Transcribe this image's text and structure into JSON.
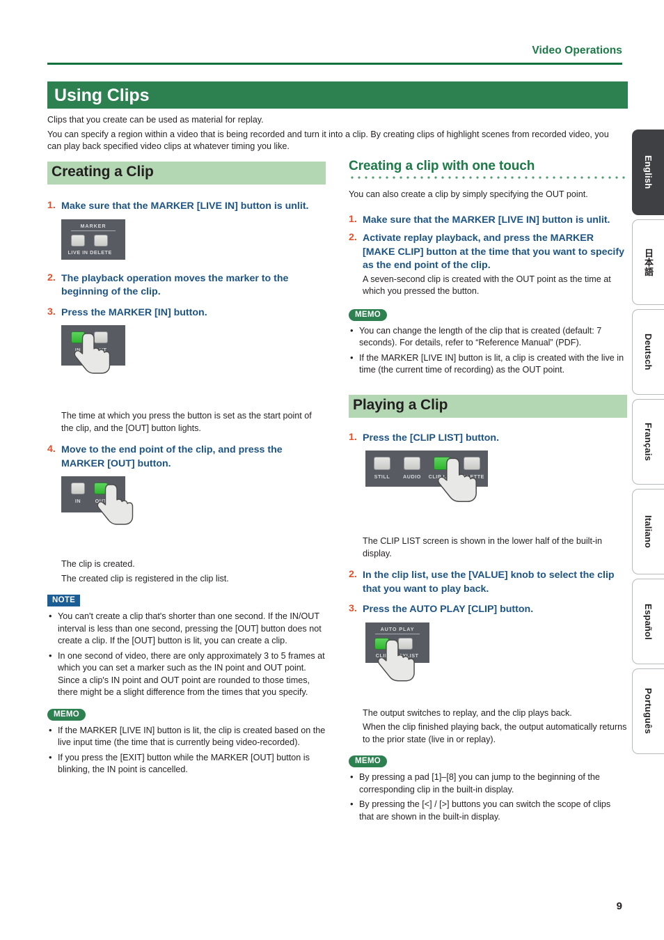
{
  "header": {
    "running_head": "Video Operations",
    "chapter_title": "Using Clips"
  },
  "intro": {
    "line1": "Clips that you create can be used as material for replay.",
    "line2": "You can specify a region within a video that is being recorded and turn it into a clip. By creating clips of highlight scenes from recorded video, you can play back specified video clips at whatever timing you like."
  },
  "left_column": {
    "heading": "Creating a Clip",
    "steps": [
      {
        "num": "1.",
        "text": "Make sure that the MARKER [LIVE IN] button is unlit."
      },
      {
        "num": "2.",
        "text": "The playback operation moves the marker to the beginning of the clip."
      },
      {
        "num": "3.",
        "text": "Press the MARKER [IN] button."
      },
      {
        "num": "4.",
        "text": "Move to the end point of the clip, and press the MARKER [OUT] button."
      }
    ],
    "step3_result": "The time at which you press the button is set as the start point of the clip, and the [OUT] button lights.",
    "step4_result_1": "The clip is created.",
    "step4_result_2": "The created clip is registered in the clip list.",
    "panel_marker": {
      "caption": "MARKER",
      "buttons": [
        {
          "label": "LIVE IN",
          "state": "unlit"
        },
        {
          "label": "DELETE",
          "state": "unlit"
        }
      ]
    },
    "panel_in": {
      "buttons": [
        {
          "label": "IN",
          "state": "lit"
        },
        {
          "label": "OUT",
          "state": "unlit"
        }
      ]
    },
    "panel_out": {
      "buttons": [
        {
          "label": "IN",
          "state": "unlit"
        },
        {
          "label": "OUT",
          "state": "lit"
        }
      ]
    },
    "note": {
      "badge": "NOTE",
      "items": [
        "You can't create a clip that's shorter than one second. If the IN/OUT interval is less than one second, pressing the [OUT] button does not create a clip. If the [OUT] button is lit, you can create a clip.",
        "In one second of video, there are only approximately 3 to 5 frames at which you can set a marker such as the IN point and OUT point. Since a clip's IN point and OUT point are rounded to those times, there might be a slight difference from the times that you specify."
      ]
    },
    "memo": {
      "badge": "MEMO",
      "items": [
        "If the MARKER [LIVE IN] button is lit, the clip is created based on the live input time (the time that is currently being video-recorded).",
        "If you press the [EXIT] button while the MARKER [OUT] button is blinking, the IN point is cancelled."
      ]
    }
  },
  "right_column": {
    "subheading": "Creating a clip with one touch",
    "lead": "You can also create a clip by simply specifying the OUT point.",
    "one_touch_steps": [
      {
        "num": "1.",
        "text": "Make sure that the MARKER [LIVE IN] button is unlit.",
        "sub": ""
      },
      {
        "num": "2.",
        "text": "Activate replay playback, and press the MARKER [MAKE CLIP] button at the time that you want to specify as the end point of the clip.",
        "sub": "A seven-second clip is created with the OUT point as the time at which you pressed the button."
      }
    ],
    "one_touch_memo": {
      "badge": "MEMO",
      "items": [
        "You can change the length of the clip that is created (default: 7 seconds). For details, refer to “Reference Manual” (PDF).",
        "If the MARKER [LIVE IN] button is lit, a clip is created with the live in time (the current time of recording) as the OUT point."
      ]
    },
    "heading": "Playing a Clip",
    "play_steps": [
      {
        "num": "1.",
        "text": "Press the [CLIP LIST] button."
      },
      {
        "num": "2.",
        "text": "In the clip list, use the [VALUE] knob to select the clip that you want to play back."
      },
      {
        "num": "3.",
        "text": "Press the AUTO PLAY [CLIP] button."
      }
    ],
    "step1_result": "The CLIP LIST screen is shown in the lower half of the built-in display.",
    "step3_result_1": "The output switches to replay, and the clip plays back.",
    "step3_result_2": "When the clip finished playing back, the output automatically returns to the prior state (live in or replay).",
    "panel_cliplist": {
      "buttons": [
        {
          "label": "STILL",
          "state": "unlit"
        },
        {
          "label": "AUDIO",
          "state": "unlit"
        },
        {
          "label": "CLIP LIST",
          "state": "lit"
        },
        {
          "label": "PALETTE",
          "state": "unlit"
        }
      ]
    },
    "panel_autoplay": {
      "caption": "AUTO PLAY",
      "buttons": [
        {
          "label": "CLIP",
          "state": "lit"
        },
        {
          "label": "PLAYLIST",
          "state": "unlit"
        }
      ]
    },
    "play_memo": {
      "badge": "MEMO",
      "items": [
        "By pressing a pad [1]–[8] you can jump to the beginning of the corresponding clip in the built-in display.",
        "By pressing the [<] / [>] buttons you can switch the scope of clips that are shown in the built-in display."
      ]
    }
  },
  "language_tabs": [
    {
      "label": "English",
      "active": true
    },
    {
      "label": "日本語",
      "active": false
    },
    {
      "label": "Deutsch",
      "active": false
    },
    {
      "label": "Français",
      "active": false
    },
    {
      "label": "Italiano",
      "active": false
    },
    {
      "label": "Español",
      "active": false
    },
    {
      "label": "Português",
      "active": false
    }
  ],
  "page_number": "9",
  "colors": {
    "brand_green": "#2d8050",
    "pale_green": "#b3d6b3",
    "step_number": "#e2502b",
    "step_text": "#1c5486",
    "note_badge": "#1b5e96",
    "panel_bg": "#585b62",
    "lit_green": "#3ec03e"
  }
}
